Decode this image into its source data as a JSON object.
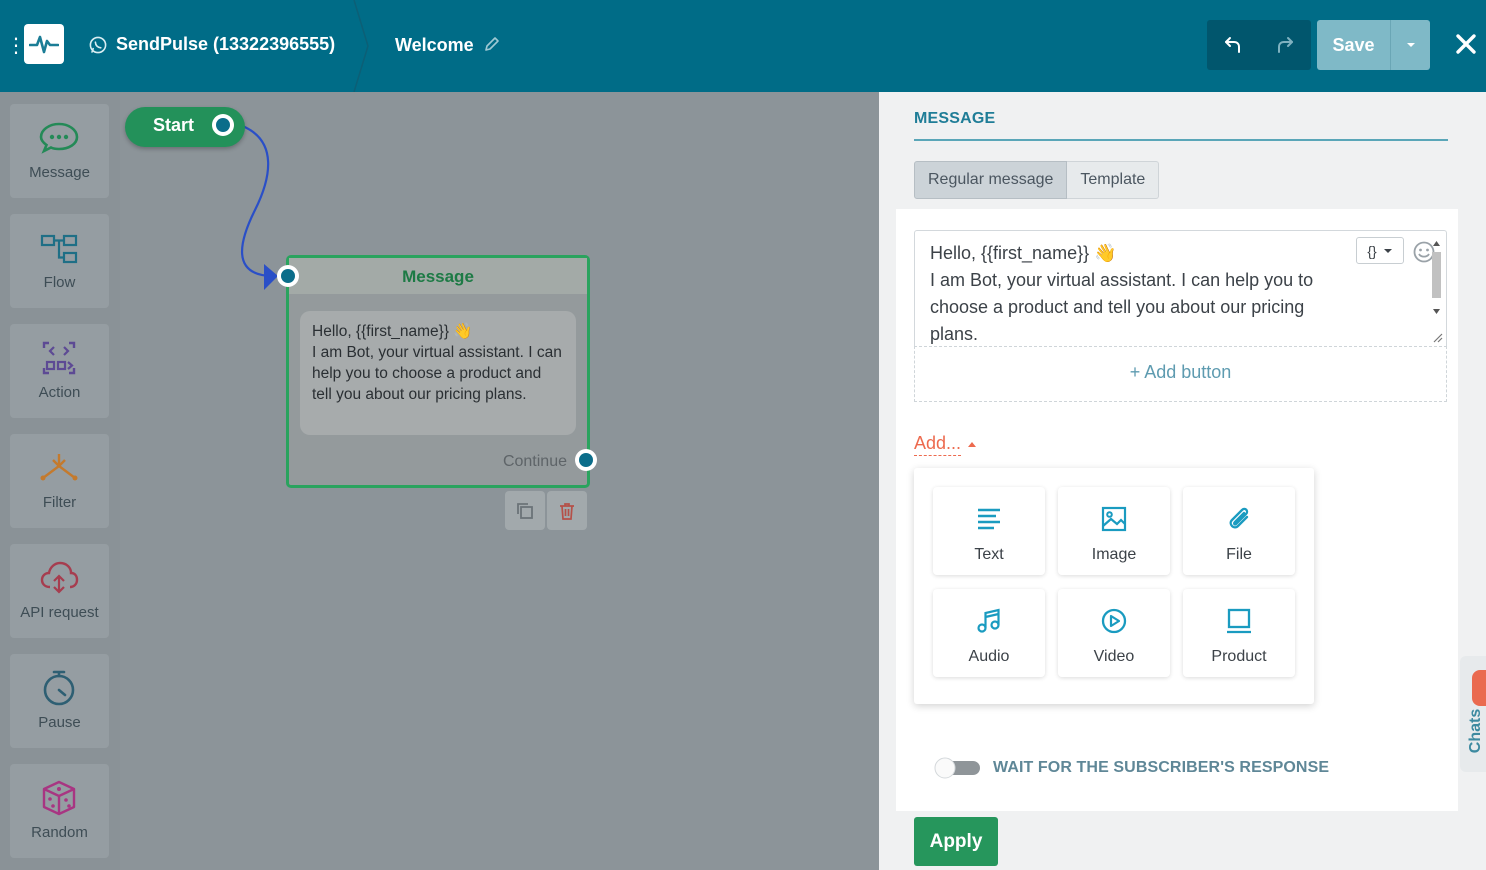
{
  "header": {
    "bot_name": "SendPulse (13322396555)",
    "flow_name": "Welcome",
    "save_label": "Save"
  },
  "sidebar": {
    "items": [
      {
        "label": "Message",
        "icon": "message-bubble-icon"
      },
      {
        "label": "Flow",
        "icon": "flow-icon"
      },
      {
        "label": "Action",
        "icon": "action-icon"
      },
      {
        "label": "Filter",
        "icon": "filter-icon"
      },
      {
        "label": "API request",
        "icon": "cloud-api-icon"
      },
      {
        "label": "Pause",
        "icon": "timer-icon"
      },
      {
        "label": "Random",
        "icon": "dice-icon"
      }
    ]
  },
  "canvas": {
    "start_label": "Start",
    "message_node": {
      "title": "Message",
      "text": "Hello,  {{first_name}} 👋\nI am Bot, your virtual assistant. I can help you to choose a product and tell you about our pricing plans.",
      "continue_label": "Continue"
    }
  },
  "panel": {
    "title": "MESSAGE",
    "tabs": [
      "Regular message",
      "Template"
    ],
    "editor_text": "Hello,  {{first_name}} 👋\nI am Bot, your virtual assistant. I can help you to choose a product and tell you about our pricing plans.",
    "var_button_label": "{}",
    "add_button_label": "+ Add button",
    "add_toggle_label": "Add...",
    "add_menu": [
      {
        "label": "Text",
        "icon": "text-lines-icon"
      },
      {
        "label": "Image",
        "icon": "image-icon"
      },
      {
        "label": "File",
        "icon": "paperclip-icon"
      },
      {
        "label": "Audio",
        "icon": "music-note-icon"
      },
      {
        "label": "Video",
        "icon": "play-circle-icon"
      },
      {
        "label": "Product",
        "icon": "product-icon"
      }
    ],
    "wait_label": "WAIT FOR THE SUBSCRIBER'S RESPONSE",
    "apply_label": "Apply"
  },
  "chats": {
    "label": "Chats"
  },
  "colors": {
    "header": "#006c87",
    "accent_green": "#26965c",
    "accent_teal": "#1f7d97",
    "add_orange": "#ed6a4e"
  }
}
